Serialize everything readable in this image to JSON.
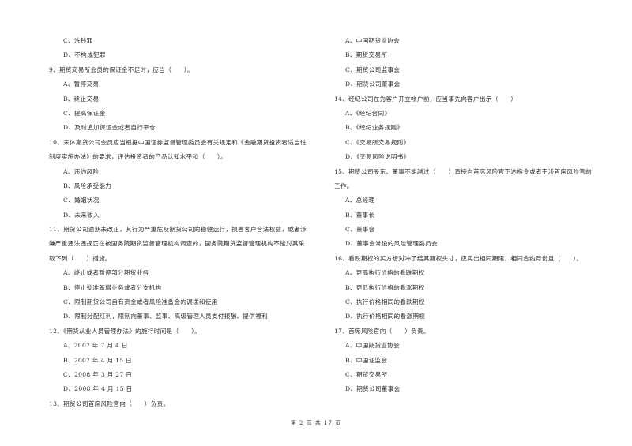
{
  "left_column": [
    {
      "type": "opt",
      "text": "C、洗钱罪"
    },
    {
      "type": "opt",
      "text": "D、不构成犯罪"
    },
    {
      "type": "q",
      "text": "9、期货交易所会员的保证金不足时，应当（　　）。"
    },
    {
      "type": "opt",
      "text": "A、暂停交易"
    },
    {
      "type": "opt",
      "text": "B、终止交易"
    },
    {
      "type": "opt",
      "text": "C、提高保证金"
    },
    {
      "type": "opt",
      "text": "D、及时追加保证金或者自行平仓"
    },
    {
      "type": "q",
      "text": "10、宋体期货公司会员应当根据中国证券监督管理委员会有关规定和《金融期货投资者适当性"
    },
    {
      "type": "q",
      "text": "制度实施办法》的要求，评估投资者的产品认知水平和（　　）。"
    },
    {
      "type": "opt",
      "text": "A、违约风险"
    },
    {
      "type": "opt",
      "text": "B、风险承受能力"
    },
    {
      "type": "opt",
      "text": "C、婚姻状况"
    },
    {
      "type": "opt",
      "text": "D、未来收入"
    },
    {
      "type": "q",
      "text": "11、期货公司逾期未改正，其行为严重危及期货公司的稳健运行，损害客户合法权益，或者涉"
    },
    {
      "type": "q",
      "text": "嫌严重违法违规正在被国务院期货监督管理机构调查的，国务院期货监督管理机构不能对其采"
    },
    {
      "type": "q",
      "text": "取下列（　　）措施。"
    },
    {
      "type": "opt",
      "text": "A、终止或者暂停部分期货业务"
    },
    {
      "type": "opt",
      "text": "B、停止批准新增业务或者分支机构"
    },
    {
      "type": "opt",
      "text": "C、限制期货公司自有资金或者风险准备金的调拨和使用"
    },
    {
      "type": "opt",
      "text": "D、限制分配红利，限制向董事、监事、高级管理人员支付报酬、提供福利"
    },
    {
      "type": "q",
      "text": "12、《期货从业人员管理办法》的施行时间是（　　）。"
    },
    {
      "type": "opt",
      "text": "A、2007 年 7 月 4 日"
    },
    {
      "type": "opt",
      "text": "B、2007 年 4 月 15 日"
    },
    {
      "type": "opt",
      "text": "C、2008 年 3 月 27 日"
    },
    {
      "type": "opt",
      "text": "D、2008 年 4 月 15 日"
    },
    {
      "type": "q",
      "text": "13、期货公司首席风险官向（　　）负责。"
    }
  ],
  "right_column": [
    {
      "type": "opt",
      "text": "A、中国期货业协会"
    },
    {
      "type": "opt",
      "text": "B、期货交易所"
    },
    {
      "type": "opt",
      "text": "C、期货公司监事会"
    },
    {
      "type": "opt",
      "text": "D、期货公司董事会"
    },
    {
      "type": "q",
      "text": "14、经纪公司在为客户开立帐户前，应当事先向客户出示（　　）"
    },
    {
      "type": "opt",
      "text": "A、《经纪合同》"
    },
    {
      "type": "opt",
      "text": "B、《经纪业务规则》"
    },
    {
      "type": "opt",
      "text": "C、《交易所交易规则》"
    },
    {
      "type": "opt",
      "text": "D、《交易风险说明书》"
    },
    {
      "type": "q",
      "text": "15、期货公司股东、董事不能越过（　　）直接向首席风险官下达指令或者干涉首席风险官的"
    },
    {
      "type": "q",
      "text": "工作。"
    },
    {
      "type": "opt",
      "text": "A、总经理"
    },
    {
      "type": "opt",
      "text": "B、董事长"
    },
    {
      "type": "opt",
      "text": "C、董事会"
    },
    {
      "type": "opt",
      "text": "D、董事会常设的风险管理委员会"
    },
    {
      "type": "q",
      "text": "16、看跌期权的买方想对冲了结其期权头寸，应卖出相同期限，相同合约月份且（　　）。"
    },
    {
      "type": "opt",
      "text": "A、更高执行价格的看跌期权"
    },
    {
      "type": "opt",
      "text": "B、更低执行价格的看涨期权"
    },
    {
      "type": "opt",
      "text": "C、执行价格相同的看跌期权"
    },
    {
      "type": "opt",
      "text": "D、执行价格相同的看涨期权"
    },
    {
      "type": "q",
      "text": "17、首席风险官向（　　）负责。"
    },
    {
      "type": "opt",
      "text": "A、中国期货业协会"
    },
    {
      "type": "opt",
      "text": "B、中国证监会"
    },
    {
      "type": "opt",
      "text": "C、期货交易所"
    },
    {
      "type": "opt",
      "text": "D、期货公司董事会"
    }
  ],
  "footer": {
    "page_label": "第 2 页 共 17 页"
  }
}
